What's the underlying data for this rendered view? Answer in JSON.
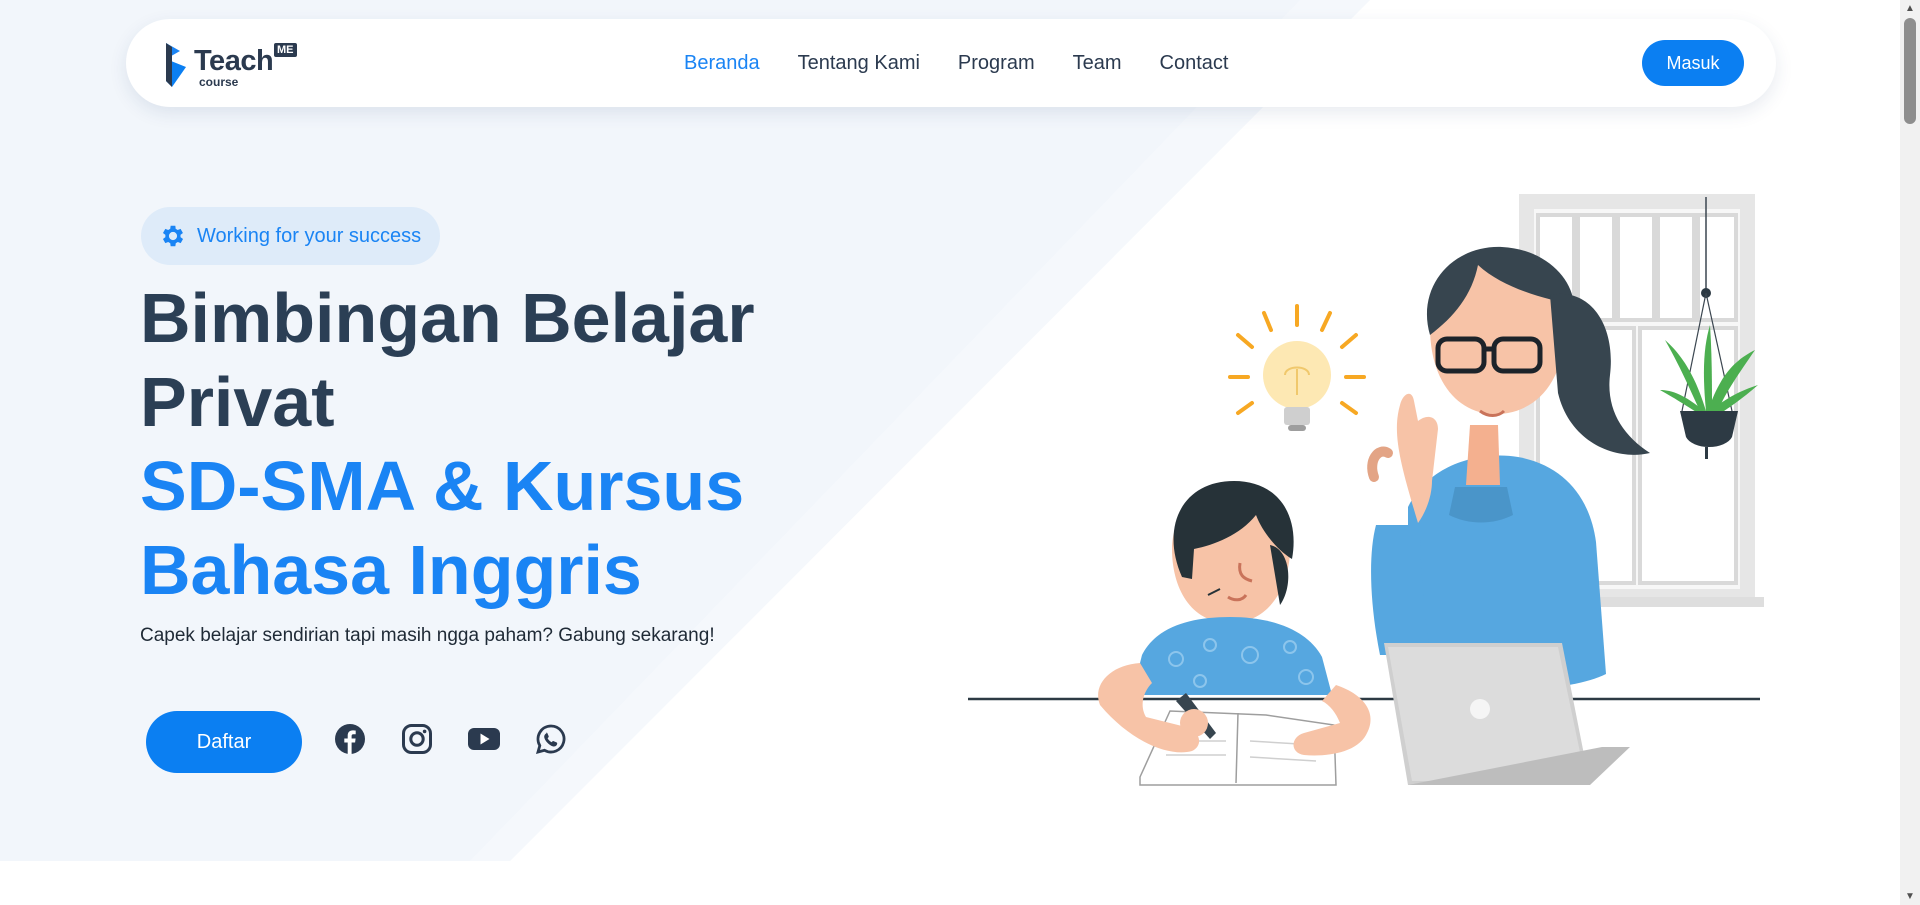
{
  "brand": {
    "name": "Teach",
    "badge": "ME",
    "sub": "course"
  },
  "nav": {
    "items": [
      "Beranda",
      "Tentang Kami",
      "Program",
      "Team",
      "Contact"
    ],
    "active_index": 0,
    "login_label": "Masuk"
  },
  "hero": {
    "badge_text": "Working for your success",
    "badge_icon": "gear-icon",
    "title_line1": "Bimbingan Belajar",
    "title_line2": "Privat",
    "title_line3": "SD-SMA & Kursus",
    "title_line4": "Bahasa Inggris",
    "subtitle": "Capek belajar sendirian tapi masih ngga paham? Gabung sekarang!",
    "register_label": "Daftar",
    "socials": [
      "facebook-icon",
      "instagram-icon",
      "youtube-icon",
      "whatsapp-icon"
    ]
  },
  "colors": {
    "accent": "#0b7ff2",
    "heading_dark": "#2b3f55",
    "hero_bg": "#f2f6fb"
  }
}
